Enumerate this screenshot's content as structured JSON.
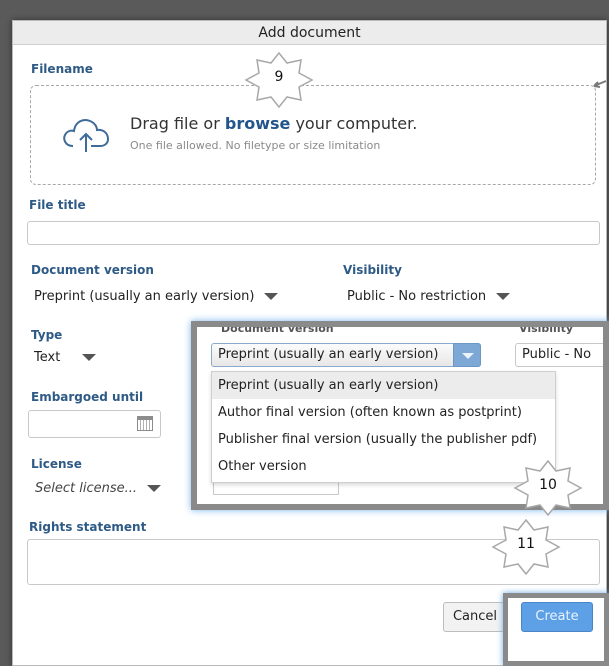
{
  "dialog": {
    "title": "Add document",
    "filename_label": "Filename",
    "dropzone": {
      "text_pre": "Drag file or ",
      "text_link": "browse",
      "text_post": " your computer.",
      "subtext": "One file allowed. No filetype or size limitation",
      "icon": "cloud-upload-icon"
    },
    "file_title_label": "File title",
    "file_title_value": "",
    "document_version_label": "Document version",
    "document_version_value": "Preprint (usually an early version)",
    "visibility_label": "Visibility",
    "visibility_value": "Public - No restriction",
    "type_label": "Type",
    "type_value": "Text",
    "embargoed_label": "Embargoed until",
    "embargoed_value": "",
    "license_label": "License",
    "license_placeholder": "Select license...",
    "rights_label": "Rights statement",
    "rights_value": "",
    "cancel_label": "Cancel",
    "create_label": "Create"
  },
  "callout": {
    "ghost_version_label": "Document version",
    "ghost_visibility_label": "Visibility",
    "selected": "Preprint (usually an early version)",
    "visibility_value": "Public - No",
    "options": [
      "Preprint (usually an early version)",
      "Author final version (often known as postprint)",
      "Publisher final version (usually the publisher pdf)",
      "Other version"
    ]
  },
  "badges": {
    "b9": "9",
    "b10": "10",
    "b11": "11"
  },
  "colors": {
    "label_blue": "#2e5a86",
    "link_blue": "#23558c",
    "create_blue": "#5ea0e6",
    "highlight_glow": "#79b4ef"
  }
}
